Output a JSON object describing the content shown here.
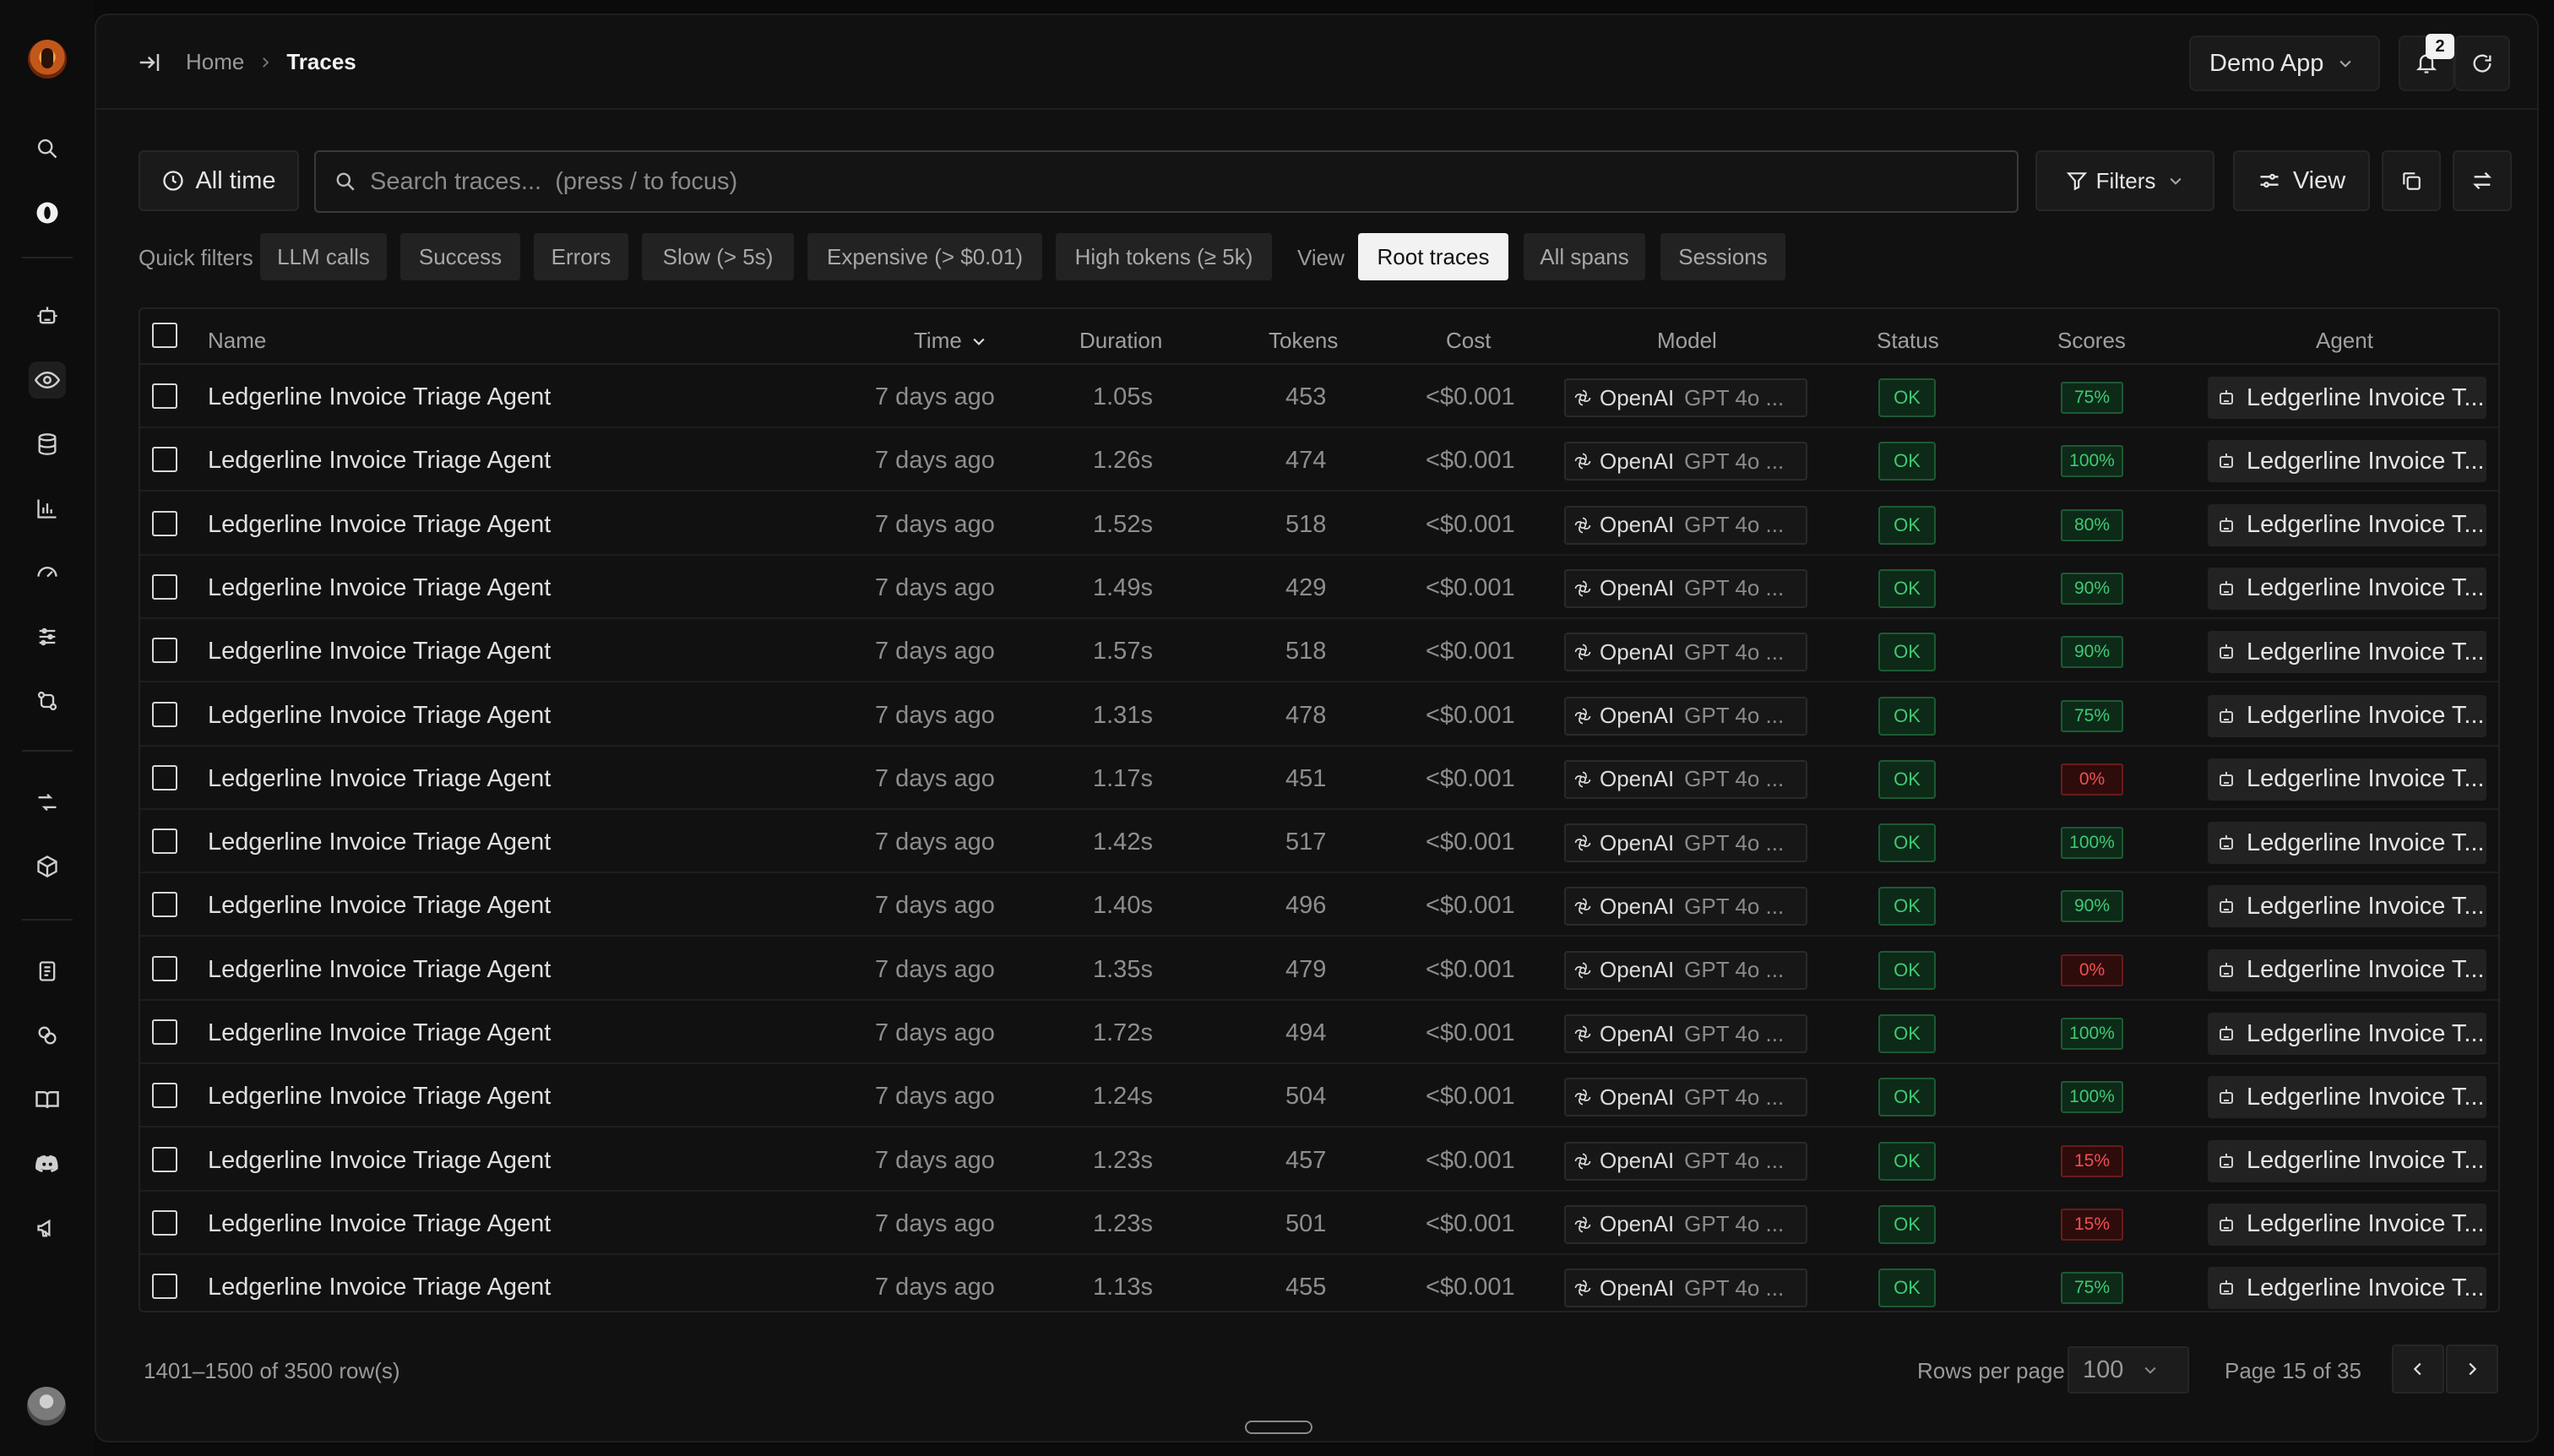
{
  "header": {
    "breadcrumb_home": "Home",
    "breadcrumb_current": "Traces",
    "app_name": "Demo App",
    "notification_count": "2"
  },
  "toolbar": {
    "time_range": "All time",
    "search_placeholder": "Search traces...  (press / to focus)",
    "filters_label": "Filters",
    "view_label": "View"
  },
  "quick_filters": {
    "label": "Quick filters",
    "chips": [
      "LLM calls",
      "Success",
      "Errors",
      "Slow (> 5s)",
      "Expensive (> $0.01)",
      "High tokens (≥ 5k)"
    ],
    "view_label": "View",
    "view_options": [
      "Root traces",
      "All spans",
      "Sessions"
    ],
    "active_view": "Root traces"
  },
  "table": {
    "columns": {
      "name": "Name",
      "time": "Time",
      "duration": "Duration",
      "tokens": "Tokens",
      "cost": "Cost",
      "model": "Model",
      "status": "Status",
      "scores": "Scores",
      "agent": "Agent"
    },
    "rows": [
      {
        "name": "Ledgerline Invoice Triage Agent",
        "time": "7 days ago",
        "duration": "1.05s",
        "tokens": "453",
        "cost": "<$0.001",
        "provider": "OpenAI",
        "model": "GPT 4o ...",
        "status": "OK",
        "score": "75%",
        "score_good": true,
        "agent": "Ledgerline Invoice T..."
      },
      {
        "name": "Ledgerline Invoice Triage Agent",
        "time": "7 days ago",
        "duration": "1.26s",
        "tokens": "474",
        "cost": "<$0.001",
        "provider": "OpenAI",
        "model": "GPT 4o ...",
        "status": "OK",
        "score": "100%",
        "score_good": true,
        "agent": "Ledgerline Invoice T..."
      },
      {
        "name": "Ledgerline Invoice Triage Agent",
        "time": "7 days ago",
        "duration": "1.52s",
        "tokens": "518",
        "cost": "<$0.001",
        "provider": "OpenAI",
        "model": "GPT 4o ...",
        "status": "OK",
        "score": "80%",
        "score_good": true,
        "agent": "Ledgerline Invoice T..."
      },
      {
        "name": "Ledgerline Invoice Triage Agent",
        "time": "7 days ago",
        "duration": "1.49s",
        "tokens": "429",
        "cost": "<$0.001",
        "provider": "OpenAI",
        "model": "GPT 4o ...",
        "status": "OK",
        "score": "90%",
        "score_good": true,
        "agent": "Ledgerline Invoice T..."
      },
      {
        "name": "Ledgerline Invoice Triage Agent",
        "time": "7 days ago",
        "duration": "1.57s",
        "tokens": "518",
        "cost": "<$0.001",
        "provider": "OpenAI",
        "model": "GPT 4o ...",
        "status": "OK",
        "score": "90%",
        "score_good": true,
        "agent": "Ledgerline Invoice T..."
      },
      {
        "name": "Ledgerline Invoice Triage Agent",
        "time": "7 days ago",
        "duration": "1.31s",
        "tokens": "478",
        "cost": "<$0.001",
        "provider": "OpenAI",
        "model": "GPT 4o ...",
        "status": "OK",
        "score": "75%",
        "score_good": true,
        "agent": "Ledgerline Invoice T..."
      },
      {
        "name": "Ledgerline Invoice Triage Agent",
        "time": "7 days ago",
        "duration": "1.17s",
        "tokens": "451",
        "cost": "<$0.001",
        "provider": "OpenAI",
        "model": "GPT 4o ...",
        "status": "OK",
        "score": "0%",
        "score_good": false,
        "agent": "Ledgerline Invoice T..."
      },
      {
        "name": "Ledgerline Invoice Triage Agent",
        "time": "7 days ago",
        "duration": "1.42s",
        "tokens": "517",
        "cost": "<$0.001",
        "provider": "OpenAI",
        "model": "GPT 4o ...",
        "status": "OK",
        "score": "100%",
        "score_good": true,
        "agent": "Ledgerline Invoice T..."
      },
      {
        "name": "Ledgerline Invoice Triage Agent",
        "time": "7 days ago",
        "duration": "1.40s",
        "tokens": "496",
        "cost": "<$0.001",
        "provider": "OpenAI",
        "model": "GPT 4o ...",
        "status": "OK",
        "score": "90%",
        "score_good": true,
        "agent": "Ledgerline Invoice T..."
      },
      {
        "name": "Ledgerline Invoice Triage Agent",
        "time": "7 days ago",
        "duration": "1.35s",
        "tokens": "479",
        "cost": "<$0.001",
        "provider": "OpenAI",
        "model": "GPT 4o ...",
        "status": "OK",
        "score": "0%",
        "score_good": false,
        "agent": "Ledgerline Invoice T..."
      },
      {
        "name": "Ledgerline Invoice Triage Agent",
        "time": "7 days ago",
        "duration": "1.72s",
        "tokens": "494",
        "cost": "<$0.001",
        "provider": "OpenAI",
        "model": "GPT 4o ...",
        "status": "OK",
        "score": "100%",
        "score_good": true,
        "agent": "Ledgerline Invoice T..."
      },
      {
        "name": "Ledgerline Invoice Triage Agent",
        "time": "7 days ago",
        "duration": "1.24s",
        "tokens": "504",
        "cost": "<$0.001",
        "provider": "OpenAI",
        "model": "GPT 4o ...",
        "status": "OK",
        "score": "100%",
        "score_good": true,
        "agent": "Ledgerline Invoice T..."
      },
      {
        "name": "Ledgerline Invoice Triage Agent",
        "time": "7 days ago",
        "duration": "1.23s",
        "tokens": "457",
        "cost": "<$0.001",
        "provider": "OpenAI",
        "model": "GPT 4o ...",
        "status": "OK",
        "score": "15%",
        "score_good": false,
        "agent": "Ledgerline Invoice T..."
      },
      {
        "name": "Ledgerline Invoice Triage Agent",
        "time": "7 days ago",
        "duration": "1.23s",
        "tokens": "501",
        "cost": "<$0.001",
        "provider": "OpenAI",
        "model": "GPT 4o ...",
        "status": "OK",
        "score": "15%",
        "score_good": false,
        "agent": "Ledgerline Invoice T..."
      },
      {
        "name": "Ledgerline Invoice Triage Agent",
        "time": "7 days ago",
        "duration": "1.13s",
        "tokens": "455",
        "cost": "<$0.001",
        "provider": "OpenAI",
        "model": "GPT 4o ...",
        "status": "OK",
        "score": "75%",
        "score_good": true,
        "agent": "Ledgerline Invoice T..."
      }
    ]
  },
  "footer": {
    "row_range": "1401–1500 of 3500 row(s)",
    "rows_per_page_label": "Rows per page",
    "rows_per_page": "100",
    "page_info": "Page 15 of 35"
  },
  "colors": {
    "background": "#0b0b0b",
    "panel": "#111111",
    "ok_green": "#3fca74",
    "score_bad_red": "#ef5050",
    "active_chip": "#f2f2f2"
  }
}
